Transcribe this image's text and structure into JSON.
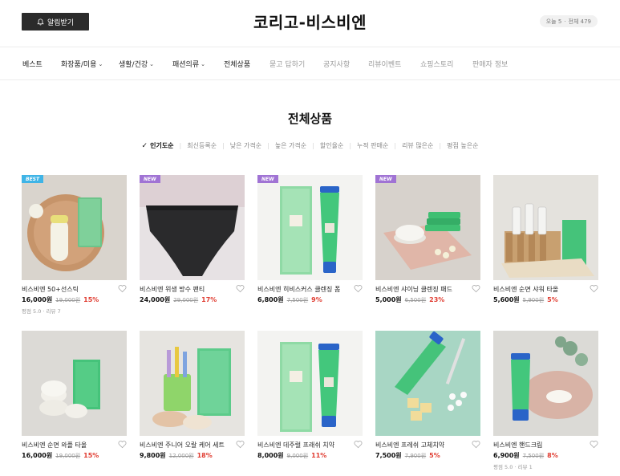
{
  "header": {
    "notify_label": "알림받기",
    "title": "코리고-비스비엔",
    "visit_today": "오늘 5",
    "visit_total": "전체 479"
  },
  "nav": [
    {
      "label": "베스트",
      "dropdown": false
    },
    {
      "label": "화장품/미용",
      "dropdown": true
    },
    {
      "label": "생활/건강",
      "dropdown": true
    },
    {
      "label": "패션의류",
      "dropdown": true
    },
    {
      "label": "전체상품",
      "dropdown": false
    },
    {
      "label": "묻고 답하기",
      "dropdown": false
    },
    {
      "label": "공지사항",
      "dropdown": false
    },
    {
      "label": "리뷰이벤트",
      "dropdown": false
    },
    {
      "label": "쇼핑스토리",
      "dropdown": false
    },
    {
      "label": "판매자 정보",
      "dropdown": false
    }
  ],
  "section_title": "전체상품",
  "sort_options": [
    "인기도순",
    "최신등록순",
    "낮은 가격순",
    "높은 가격순",
    "할인율순",
    "누적 판매순",
    "리뷰 많은순",
    "평점 높은순"
  ],
  "products": [
    {
      "name": "비스비엔 50+선스틱",
      "price": "16,000원",
      "original": "19,000원",
      "discount": "15%",
      "tag": "BEST",
      "review": "평점 5.0 · 리뷰 7"
    },
    {
      "name": "비스비엔 위생 방수 팬티",
      "price": "24,000원",
      "original": "29,000원",
      "discount": "17%",
      "tag": "NEW",
      "review": ""
    },
    {
      "name": "비스비엔 히비스커스 클렌징 폼",
      "price": "6,800원",
      "original": "7,500원",
      "discount": "9%",
      "tag": "NEW",
      "review": ""
    },
    {
      "name": "비스비엔 샤이닝 클렌징 패드",
      "price": "5,000원",
      "original": "6,500원",
      "discount": "23%",
      "tag": "NEW",
      "review": ""
    },
    {
      "name": "비스비엔 순면 샤워 타올",
      "price": "5,600원",
      "original": "5,900원",
      "discount": "5%",
      "tag": "",
      "review": ""
    },
    {
      "name": "비스비엔 순면 와플 타올",
      "price": "16,000원",
      "original": "19,000원",
      "discount": "15%",
      "tag": "",
      "review": ""
    },
    {
      "name": "비스비엔 주니어 오랄 케어 세트",
      "price": "9,800원",
      "original": "12,000원",
      "discount": "18%",
      "tag": "",
      "review": ""
    },
    {
      "name": "비스비엔 데주럴 프래쉬 치약",
      "price": "8,000원",
      "original": "9,000원",
      "discount": "11%",
      "tag": "",
      "review": ""
    },
    {
      "name": "비스비엔 프레쉬 고체치약",
      "price": "7,500원",
      "original": "7,900원",
      "discount": "5%",
      "tag": "",
      "review": ""
    },
    {
      "name": "비스비엔 핸드크림",
      "price": "6,900원",
      "original": "7,500원",
      "discount": "8%",
      "tag": "",
      "review": "평점 5.0 · 리뷰 1"
    }
  ],
  "colors": {
    "best_tag": "#3fb4e6",
    "new_tag": "#a073d4",
    "discount": "#e03c31",
    "brand_green": "#3dc87a"
  }
}
